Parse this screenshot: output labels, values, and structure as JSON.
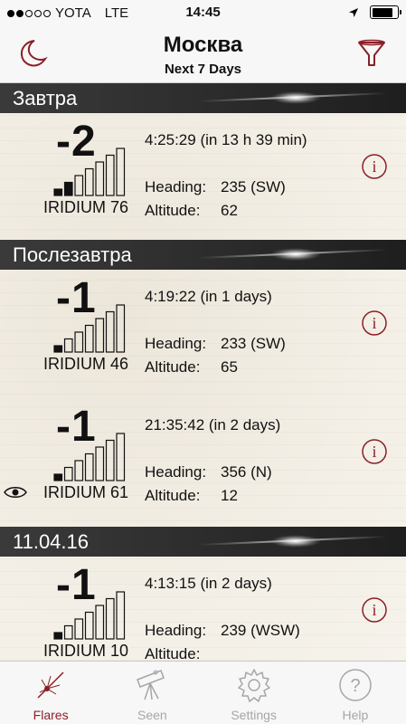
{
  "status": {
    "carrier": "YOTA",
    "network": "LTE",
    "time": "14:45",
    "signal_dots_on": 2,
    "signal_dots_total": 5
  },
  "nav": {
    "title": "Москва",
    "subtitle": "Next 7 Days",
    "left_icon": "moon-icon",
    "right_icon": "filter-icon"
  },
  "colors": {
    "accent": "#8b1f26",
    "header_bg": "#2e2e2e"
  },
  "sections": [
    {
      "title": "Завтра",
      "flares": [
        {
          "magnitude": "-2",
          "signal_level": 2,
          "satellite": "IRIDIUM 76",
          "time": "4:25:29 (in 13 h 39 min)",
          "heading_label": "Heading:",
          "heading": "235 (SW)",
          "altitude_label": "Altitude:",
          "altitude": "62",
          "seen": false
        }
      ]
    },
    {
      "title": "Послезавтра",
      "flares": [
        {
          "magnitude": "-1",
          "signal_level": 1,
          "satellite": "IRIDIUM 46",
          "time": "4:19:22 (in 1 days)",
          "heading_label": "Heading:",
          "heading": "233 (SW)",
          "altitude_label": "Altitude:",
          "altitude": "65",
          "seen": false
        },
        {
          "magnitude": "-1",
          "signal_level": 1,
          "satellite": "IRIDIUM 61",
          "time": "21:35:42 (in 2 days)",
          "heading_label": "Heading:",
          "heading": "356 (N)",
          "altitude_label": "Altitude:",
          "altitude": "12",
          "seen": true
        }
      ]
    },
    {
      "title": "11.04.16",
      "flares": [
        {
          "magnitude": "-1",
          "signal_level": 1,
          "satellite": "IRIDIUM 10",
          "time": "4:13:15 (in 2 days)",
          "heading_label": "Heading:",
          "heading": "239 (WSW)",
          "altitude_label": "Altitude:",
          "altitude": "",
          "seen": false
        }
      ]
    }
  ],
  "tabs": [
    {
      "label": "Flares",
      "icon": "flare-icon",
      "active": true
    },
    {
      "label": "Seen",
      "icon": "telescope-icon",
      "active": false
    },
    {
      "label": "Settings",
      "icon": "gear-icon",
      "active": false
    },
    {
      "label": "Help",
      "icon": "help-icon",
      "active": false
    }
  ]
}
